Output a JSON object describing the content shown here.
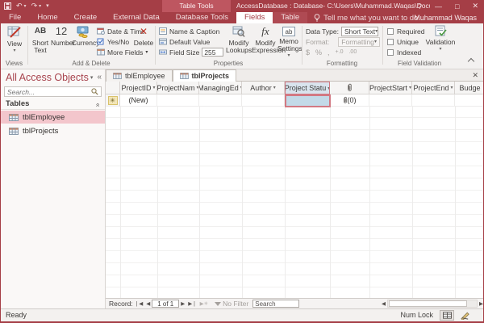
{
  "window": {
    "title": "AccessDatabase : Database- C:\\Users\\Muhammad.Waqas\\Docum...",
    "contextual_label": "Table Tools",
    "user_name": "Muhammad Waqas",
    "tell_me": "Tell me what you want to do...",
    "controls": {
      "help": "?",
      "minimize": "—",
      "maximize": "□",
      "close": "✕"
    }
  },
  "menu_tabs": {
    "file": "File",
    "home": "Home",
    "create": "Create",
    "external_data": "External Data",
    "database_tools": "Database Tools",
    "fields": "Fields",
    "table": "Table"
  },
  "ribbon": {
    "views": {
      "button": "View",
      "group": "Views"
    },
    "add_delete": {
      "short_text": "Short Text",
      "number": "Number",
      "currency": "Currency",
      "date_time": "Date & Time",
      "yes_no": "Yes/No",
      "more_fields": "More Fields",
      "delete": "Delete",
      "group": "Add & Delete"
    },
    "properties": {
      "name_caption": "Name & Caption",
      "default_value": "Default Value",
      "field_size": "Field Size",
      "field_size_value": "255",
      "modify_lookups": "Modify Lookups",
      "modify_expression": "Modify Expression",
      "memo_settings": "Memo Settings",
      "group": "Properties"
    },
    "formatting": {
      "data_type_label": "Data Type:",
      "data_type_value": "Short Text",
      "format_label": "Format:",
      "format_value": "Formatting",
      "dollar": "$",
      "percent": "%",
      "comma": ",",
      "group": "Formatting"
    },
    "field_validation": {
      "required": "Required",
      "unique": "Unique",
      "indexed": "Indexed",
      "validation": "Validation",
      "group": "Field Validation"
    }
  },
  "nav_pane": {
    "title": "All Access Objects",
    "search_placeholder": "Search...",
    "group_tables": "Tables",
    "items": [
      {
        "label": "tblEmployee"
      },
      {
        "label": "tblProjects"
      }
    ]
  },
  "doc": {
    "tabs": [
      {
        "label": "tblEmployee"
      },
      {
        "label": "tblProjects"
      }
    ],
    "columns": [
      {
        "label": "ProjectID"
      },
      {
        "label": "ProjectNam"
      },
      {
        "label": "ManagingEd"
      },
      {
        "label": "Author"
      },
      {
        "label": "Project Statu"
      },
      {
        "label": "",
        "icon": "attachment-icon"
      },
      {
        "label": "ProjectStart"
      },
      {
        "label": "ProjectEnd"
      },
      {
        "label": "Budge"
      }
    ],
    "new_row": {
      "project_id": "(New)",
      "attachment_count": "(0)"
    }
  },
  "record_nav": {
    "label": "Record:",
    "position": "1 of 1",
    "no_filter": "No Filter",
    "search": "Search"
  },
  "status_bar": {
    "ready": "Ready",
    "num_lock": "Num Lock"
  },
  "colors": {
    "accent_red": "#A53E46",
    "selection_pink": "#F3C6CC",
    "active_cell_fill": "#C3DAE8",
    "active_cell_border": "#D27983"
  }
}
